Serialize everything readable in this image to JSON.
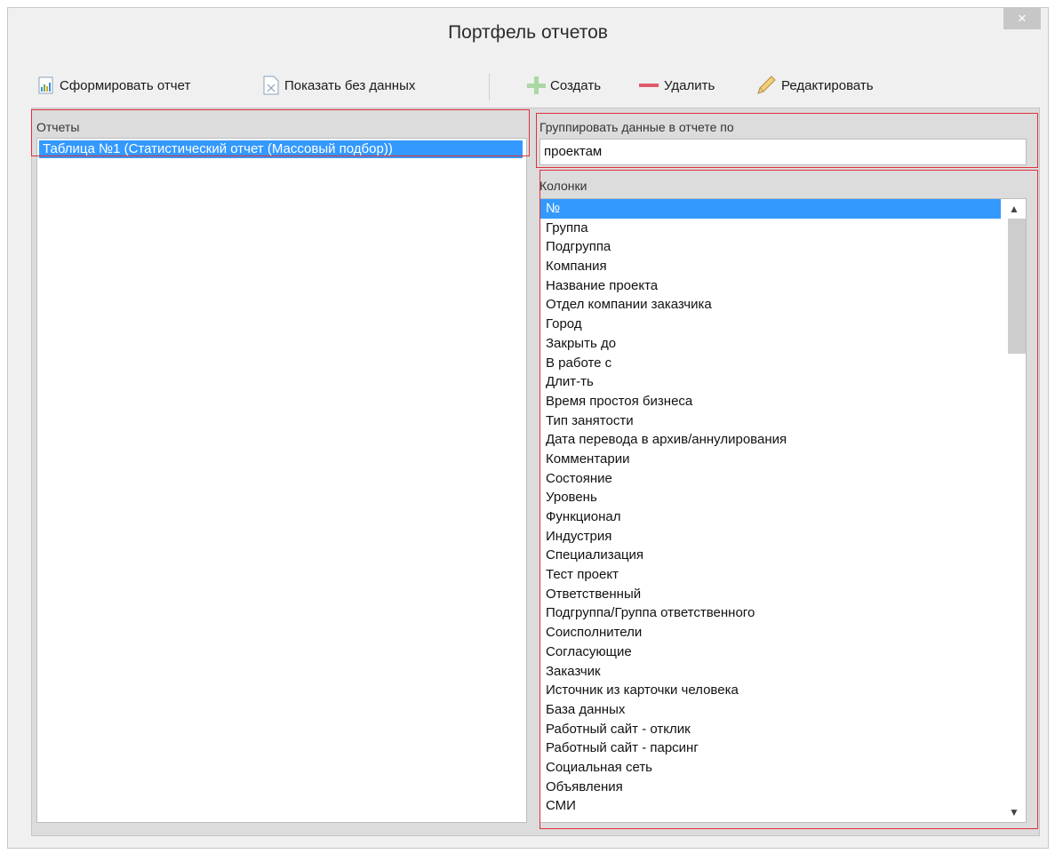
{
  "window": {
    "title": "Портфель отчетов",
    "close_glyph": "×"
  },
  "toolbar": {
    "generate_label": "Сформировать отчет",
    "show_empty_label": "Показать без данных",
    "create_label": "Создать",
    "delete_label": "Удалить",
    "edit_label": "Редактировать"
  },
  "reports": {
    "label": "Отчеты",
    "items": [
      "Таблица №1 (Статистический отчет (Массовый подбор))"
    ]
  },
  "grouping": {
    "label": "Группировать данные в отчете по",
    "value": "проектам"
  },
  "columns": {
    "label": "Колонки",
    "items": [
      "№",
      "Группа",
      "Подгруппа",
      "Компания",
      "Название проекта",
      "Отдел компании заказчика",
      "Город",
      "Закрыть до",
      "В работе с",
      "Длит-ть",
      "Время простоя бизнеса",
      "Тип занятости",
      "Дата перевода в архив/аннулирования",
      "Комментарии",
      "Состояние",
      "Уровень",
      "Функционал",
      "Индустрия",
      "Специализация",
      "Тест проект",
      "Ответственный",
      "Подгруппа/Группа ответственного",
      "Соисполнители",
      "Согласующие",
      "Заказчик",
      "Источник из карточки человека",
      "База данных",
      "Работный сайт - отклик",
      "Работный сайт - парсинг",
      "Социальная сеть",
      "Объявления",
      "СМИ"
    ],
    "selected_index": 0
  },
  "colors": {
    "selection": "#3399ff",
    "highlight_box": "#e0303c",
    "panel_bg": "#dcdcdc"
  }
}
